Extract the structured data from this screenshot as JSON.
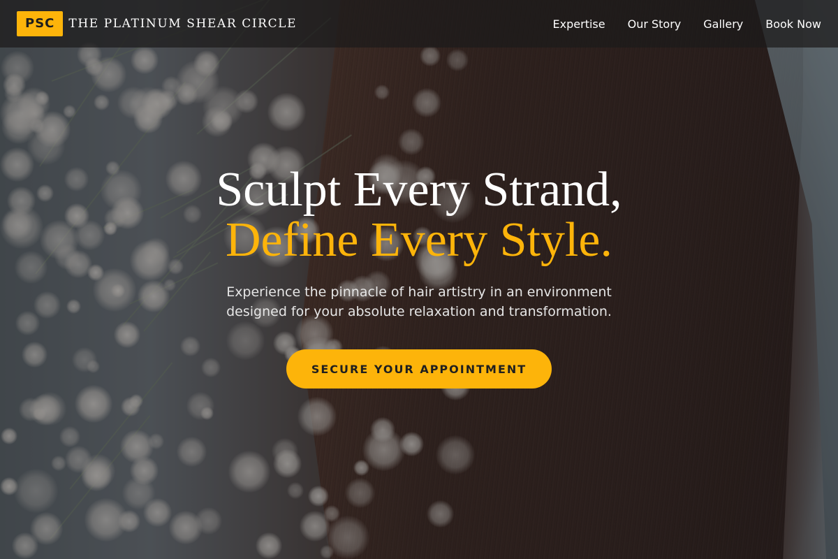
{
  "brand": {
    "badge": "PSC",
    "name": "THE PLATINUM SHEAR CIRCLE"
  },
  "nav": {
    "items": [
      {
        "label": "Expertise"
      },
      {
        "label": "Our Story"
      },
      {
        "label": "Gallery"
      },
      {
        "label": "Book Now"
      }
    ]
  },
  "hero": {
    "headline_line1": "Sculpt Every Strand,",
    "headline_line2": "Define Every Style.",
    "subtext": "Experience the pinnacle of hair artistry in an environment designed for your absolute relaxation and transformation.",
    "cta_label": "SECURE YOUR APPOINTMENT"
  },
  "colors": {
    "accent": "#fdb40a",
    "nav_background": "#1c1a1a",
    "text_light": "#ffffff"
  }
}
